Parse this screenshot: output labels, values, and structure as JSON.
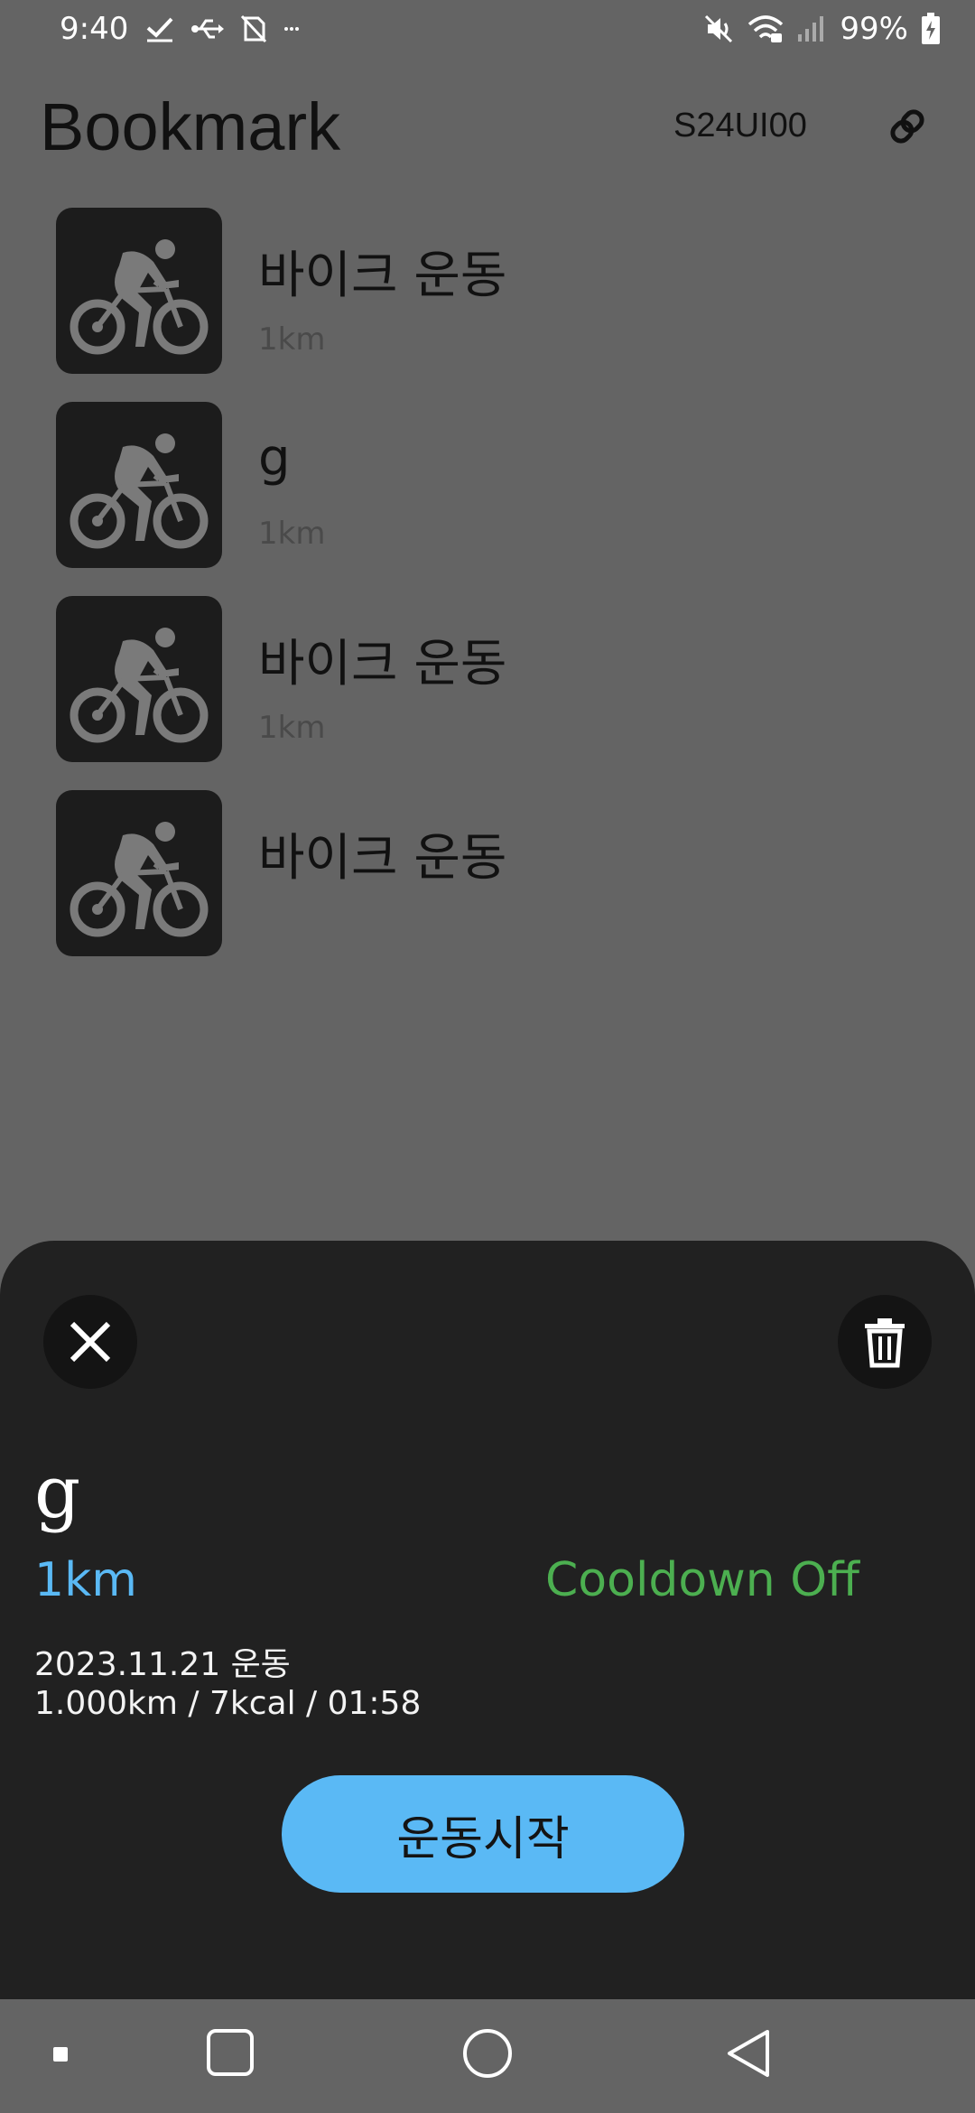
{
  "status_bar": {
    "time": "9:40",
    "battery": "99%"
  },
  "header": {
    "title": "Bookmark",
    "device_id": "S24UI00"
  },
  "bookmarks": [
    {
      "title": "바이크 운동",
      "distance": "1km",
      "icon": "bike-rider-icon"
    },
    {
      "title": "g",
      "distance": "1km",
      "icon": "bike-rider-icon"
    },
    {
      "title": "바이크 운동",
      "distance": "1km",
      "icon": "bike-rider-icon"
    },
    {
      "title": "바이크 운동",
      "distance": "",
      "icon": "bike-rider-icon"
    }
  ],
  "sheet": {
    "title": "g",
    "distance": "1km",
    "cooldown": "Cooldown Off",
    "date": "2023.11.21 운동",
    "stats": "1.000km / 7kcal / 01:58",
    "start_label": "운동시작"
  },
  "colors": {
    "accent_blue": "#5ab9f5",
    "cooldown_green": "#4caf50",
    "sheet_bg": "#212121",
    "overlay_bg": "#646464"
  }
}
